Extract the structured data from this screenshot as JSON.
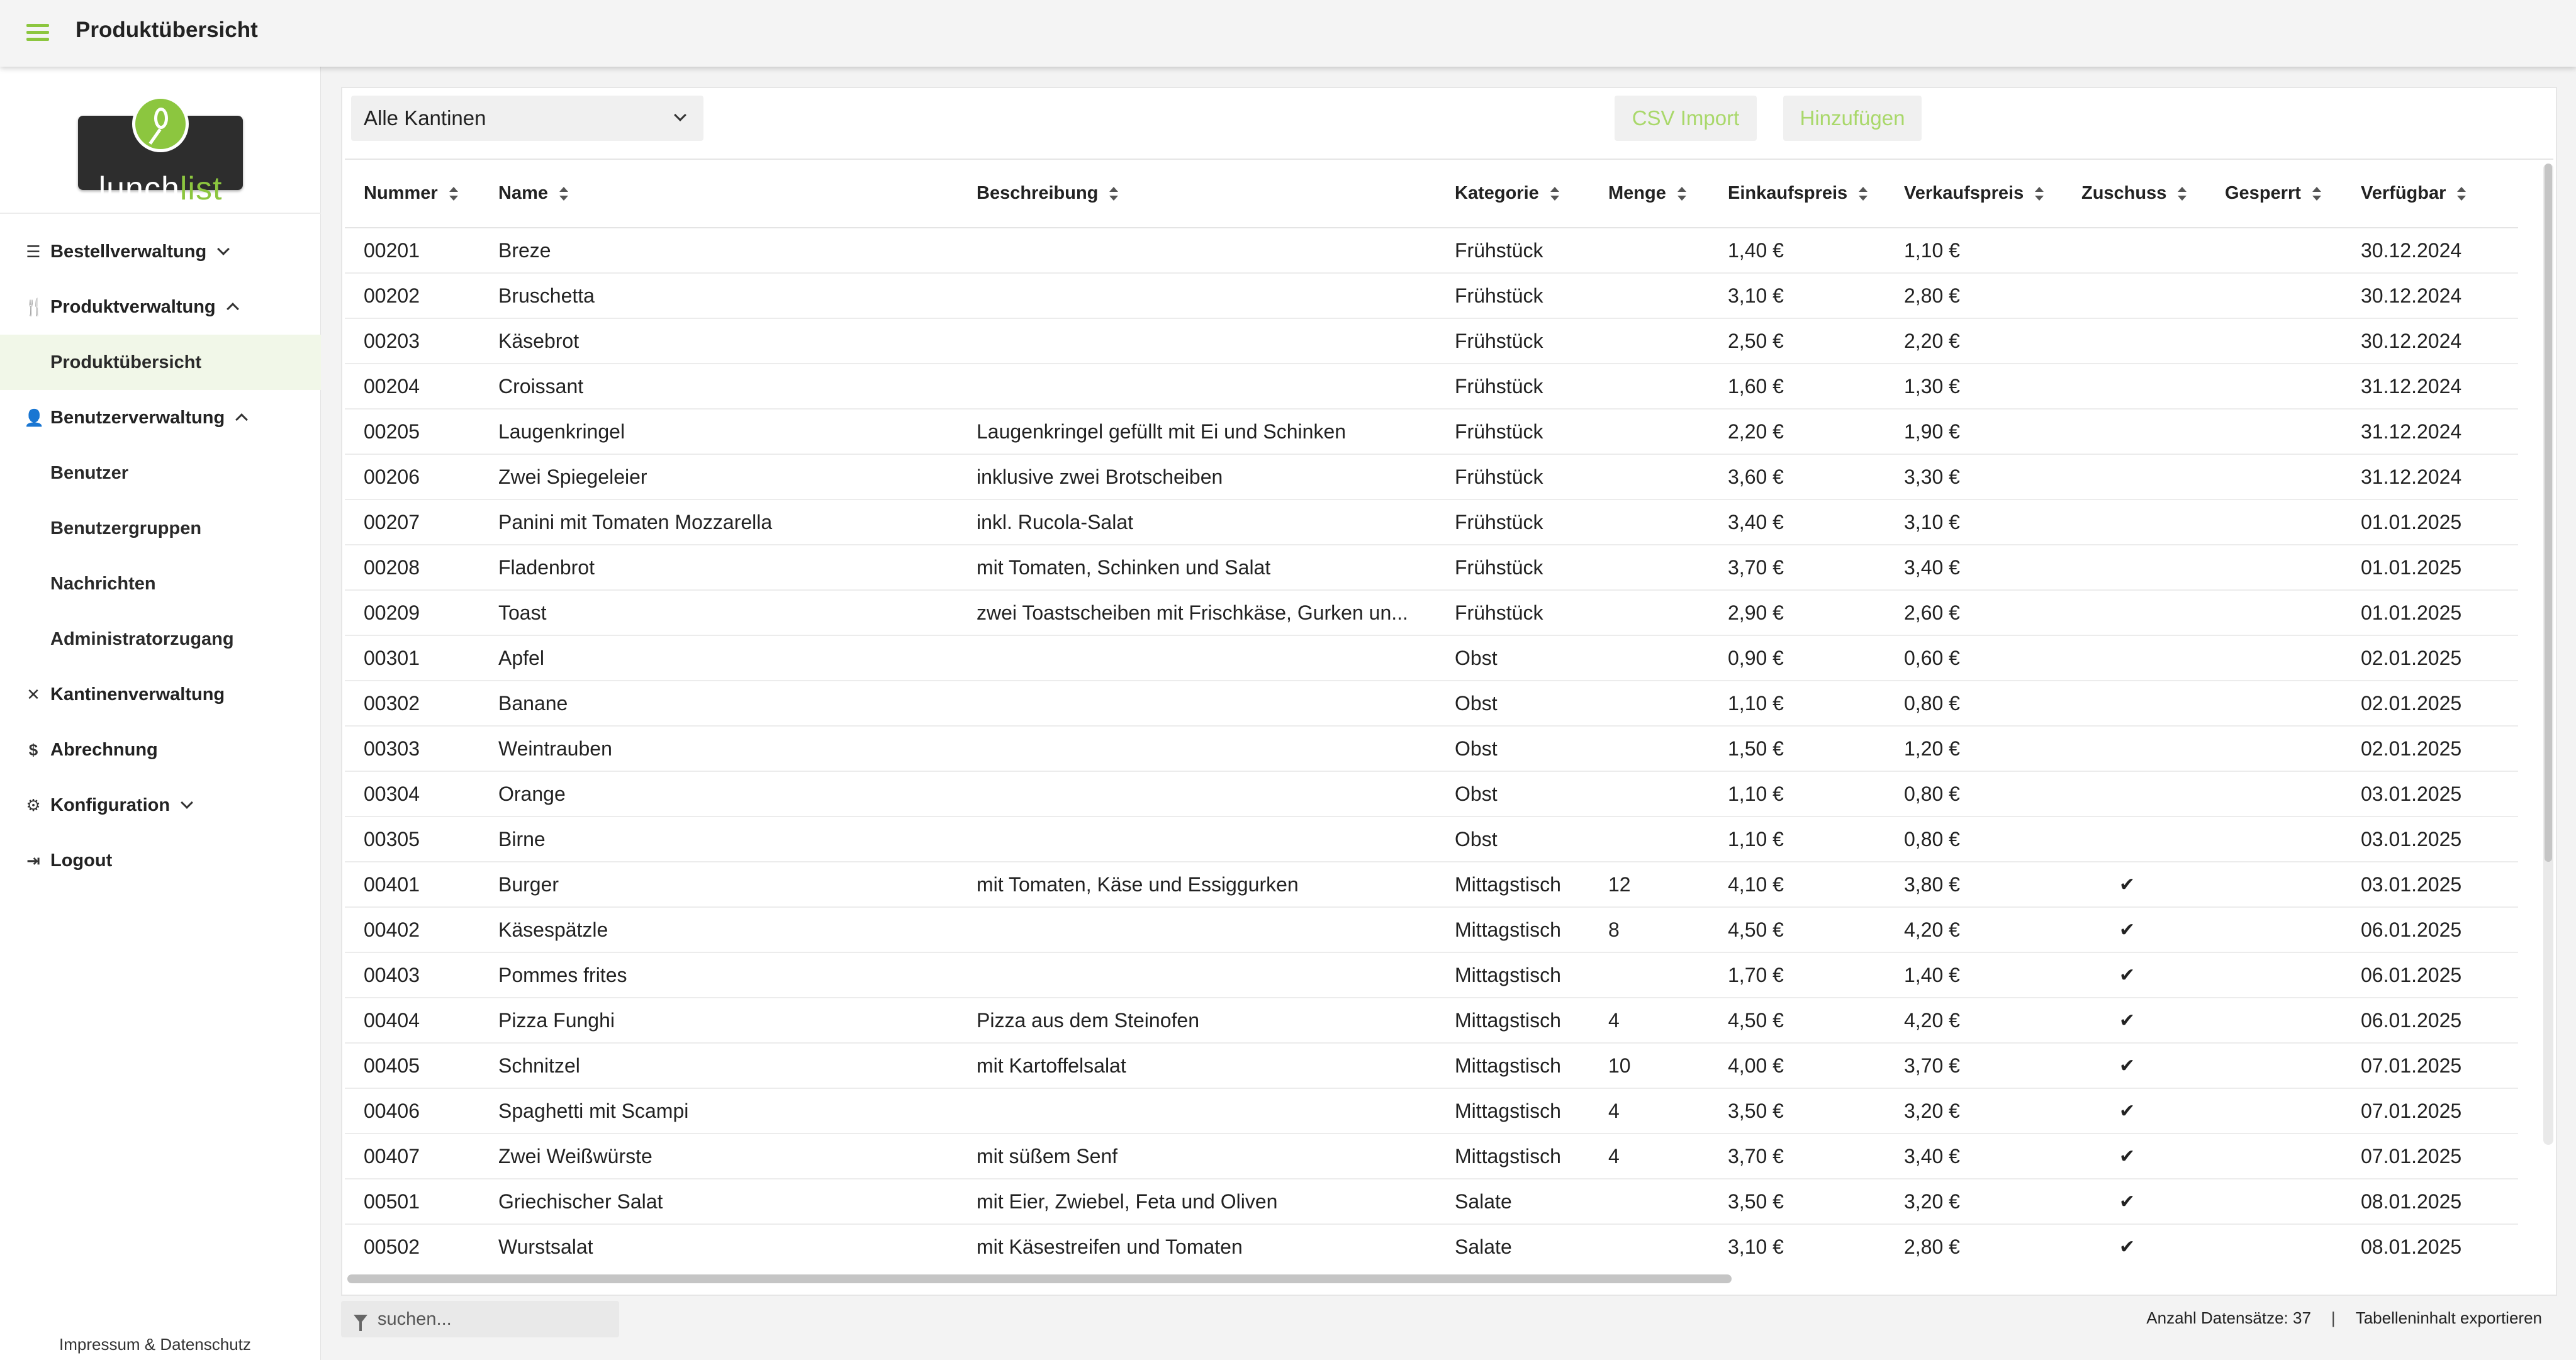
{
  "header": {
    "title": "Produktübersicht"
  },
  "icons": {
    "menu": "hamburger-icon"
  },
  "colors": {
    "accent": "#8cc63f",
    "button_text": "#a9d86a"
  },
  "logo": {
    "text_part1": "lunch",
    "text_part2": "list"
  },
  "sidebar": {
    "items": [
      {
        "label": "Bestellverwaltung",
        "icon": "list-icon",
        "glyph": "☰",
        "level": "top",
        "chevron": "down"
      },
      {
        "label": "Produktverwaltung",
        "icon": "cutlery-icon",
        "glyph": "🍴",
        "level": "top",
        "chevron": "up"
      },
      {
        "label": "Produktübersicht",
        "level": "sub",
        "active": true
      },
      {
        "label": "Benutzerverwaltung",
        "icon": "user-icon",
        "glyph": "👤",
        "level": "top",
        "chevron": "up"
      },
      {
        "label": "Benutzer",
        "level": "sub"
      },
      {
        "label": "Benutzergruppen",
        "level": "sub"
      },
      {
        "label": "Nachrichten",
        "level": "sub"
      },
      {
        "label": "Administratorzugang",
        "level": "sub"
      },
      {
        "label": "Kantinenverwaltung",
        "icon": "tools-icon",
        "glyph": "✕",
        "level": "top"
      },
      {
        "label": "Abrechnung",
        "icon": "dollar-icon",
        "glyph": "$",
        "level": "top"
      },
      {
        "label": "Konfiguration",
        "icon": "gear-icon",
        "glyph": "⚙",
        "level": "top",
        "chevron": "down"
      },
      {
        "label": "Logout",
        "icon": "logout-icon",
        "glyph": "⇥",
        "level": "top"
      }
    ],
    "footer": "Impressum & Datenschutz"
  },
  "toolbar": {
    "select_value": "Alle Kantinen",
    "csv_import": "CSV Import",
    "add": "Hinzufügen"
  },
  "table": {
    "columns": [
      "Nummer",
      "Name",
      "Beschreibung",
      "Kategorie",
      "Menge",
      "Einkaufspreis",
      "Verkaufspreis",
      "Zuschuss",
      "Gesperrt",
      "Verfügbar"
    ],
    "rows": [
      [
        "00201",
        "Breze",
        "",
        "Frühstück",
        "",
        "1,40 €",
        "1,10 €",
        "",
        "",
        "30.12.2024"
      ],
      [
        "00202",
        "Bruschetta",
        "",
        "Frühstück",
        "",
        "3,10 €",
        "2,80 €",
        "",
        "",
        "30.12.2024"
      ],
      [
        "00203",
        "Käsebrot",
        "",
        "Frühstück",
        "",
        "2,50 €",
        "2,20 €",
        "",
        "",
        "30.12.2024"
      ],
      [
        "00204",
        "Croissant",
        "",
        "Frühstück",
        "",
        "1,60 €",
        "1,30 €",
        "",
        "",
        "31.12.2024"
      ],
      [
        "00205",
        "Laugenkringel",
        "Laugenkringel gefüllt mit Ei und Schinken",
        "Frühstück",
        "",
        "2,20 €",
        "1,90 €",
        "",
        "",
        "31.12.2024"
      ],
      [
        "00206",
        "Zwei Spiegeleier",
        "inklusive zwei Brotscheiben",
        "Frühstück",
        "",
        "3,60 €",
        "3,30 €",
        "",
        "",
        "31.12.2024"
      ],
      [
        "00207",
        "Panini mit Tomaten Mozzarella",
        "inkl. Rucola-Salat",
        "Frühstück",
        "",
        "3,40 €",
        "3,10 €",
        "",
        "",
        "01.01.2025"
      ],
      [
        "00208",
        "Fladenbrot",
        "mit Tomaten, Schinken und Salat",
        "Frühstück",
        "",
        "3,70 €",
        "3,40 €",
        "",
        "",
        "01.01.2025"
      ],
      [
        "00209",
        "Toast",
        "zwei Toastscheiben mit Frischkäse, Gurken un...",
        "Frühstück",
        "",
        "2,90 €",
        "2,60 €",
        "",
        "",
        "01.01.2025"
      ],
      [
        "00301",
        "Apfel",
        "",
        "Obst",
        "",
        "0,90 €",
        "0,60 €",
        "",
        "",
        "02.01.2025"
      ],
      [
        "00302",
        "Banane",
        "",
        "Obst",
        "",
        "1,10 €",
        "0,80 €",
        "",
        "",
        "02.01.2025"
      ],
      [
        "00303",
        "Weintrauben",
        "",
        "Obst",
        "",
        "1,50 €",
        "1,20 €",
        "",
        "",
        "02.01.2025"
      ],
      [
        "00304",
        "Orange",
        "",
        "Obst",
        "",
        "1,10 €",
        "0,80 €",
        "",
        "",
        "03.01.2025"
      ],
      [
        "00305",
        "Birne",
        "",
        "Obst",
        "",
        "1,10 €",
        "0,80 €",
        "",
        "",
        "03.01.2025"
      ],
      [
        "00401",
        "Burger",
        "mit Tomaten, Käse und Essiggurken",
        "Mittagstisch",
        "12",
        "4,10 €",
        "3,80 €",
        "✔",
        "",
        "03.01.2025"
      ],
      [
        "00402",
        "Käsespätzle",
        "",
        "Mittagstisch",
        "8",
        "4,50 €",
        "4,20 €",
        "✔",
        "",
        "06.01.2025"
      ],
      [
        "00403",
        "Pommes frites",
        "",
        "Mittagstisch",
        "",
        "1,70 €",
        "1,40 €",
        "✔",
        "",
        "06.01.2025"
      ],
      [
        "00404",
        "Pizza Funghi",
        "Pizza aus dem Steinofen",
        "Mittagstisch",
        "4",
        "4,50 €",
        "4,20 €",
        "✔",
        "",
        "06.01.2025"
      ],
      [
        "00405",
        "Schnitzel",
        "mit Kartoffelsalat",
        "Mittagstisch",
        "10",
        "4,00 €",
        "3,70 €",
        "✔",
        "",
        "07.01.2025"
      ],
      [
        "00406",
        "Spaghetti mit Scampi",
        "",
        "Mittagstisch",
        "4",
        "3,50 €",
        "3,20 €",
        "✔",
        "",
        "07.01.2025"
      ],
      [
        "00407",
        "Zwei Weißwürste",
        "mit süßem Senf",
        "Mittagstisch",
        "4",
        "3,70 €",
        "3,40 €",
        "✔",
        "",
        "07.01.2025"
      ],
      [
        "00501",
        "Griechischer Salat",
        "mit Eier, Zwiebel, Feta und Oliven",
        "Salate",
        "",
        "3,50 €",
        "3,20 €",
        "✔",
        "",
        "08.01.2025"
      ],
      [
        "00502",
        "Wurstsalat",
        "mit Käsestreifen und Tomaten",
        "Salate",
        "",
        "3,10 €",
        "2,80 €",
        "✔",
        "",
        "08.01.2025"
      ]
    ]
  },
  "footer": {
    "search_placeholder": "suchen...",
    "record_count": "Anzahl Datensätze: 37",
    "separator": "|",
    "export": "Tabelleninhalt exportieren"
  }
}
